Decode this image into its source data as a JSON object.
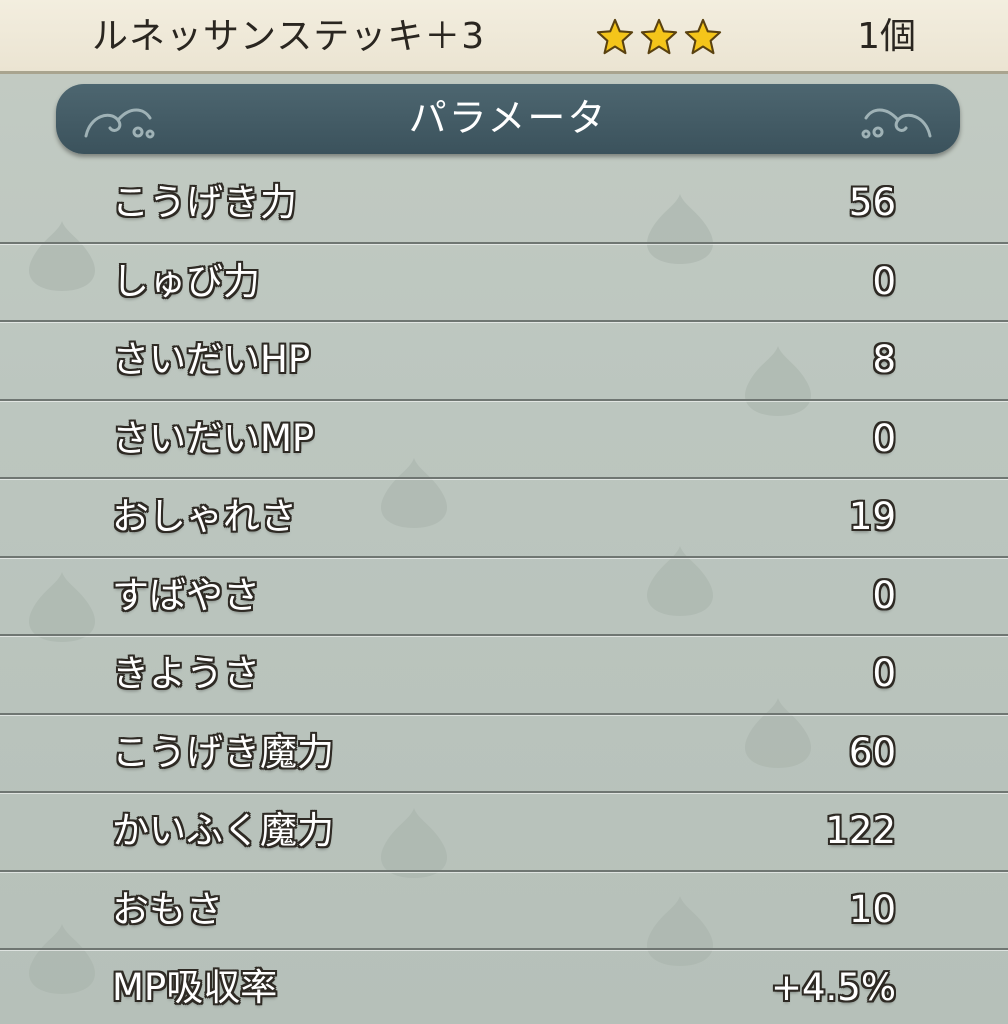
{
  "item": {
    "name": "ルネッサンステッキ＋3",
    "rarity_stars": 3,
    "count": "1個"
  },
  "header": {
    "title": "パラメータ"
  },
  "params": [
    {
      "label": "こうげき力",
      "value": "56"
    },
    {
      "label": "しゅび力",
      "value": "0"
    },
    {
      "label": "さいだいHP",
      "value": "8"
    },
    {
      "label": "さいだいMP",
      "value": "0"
    },
    {
      "label": "おしゃれさ",
      "value": "19"
    },
    {
      "label": "すばやさ",
      "value": "0"
    },
    {
      "label": "きようさ",
      "value": "0"
    },
    {
      "label": "こうげき魔力",
      "value": "60"
    },
    {
      "label": "かいふく魔力",
      "value": "122"
    },
    {
      "label": "おもさ",
      "value": "10"
    },
    {
      "label": "MP吸収率",
      "value": "+4.5%"
    }
  ],
  "colors": {
    "star": "#f4c51a",
    "header_bg": "#445c66",
    "item_bar_bg": "#efe9da",
    "background": "#bcc6bf"
  },
  "icons": [
    "star-icon",
    "flourish-ornament-icon",
    "slime-silhouette-icon"
  ]
}
